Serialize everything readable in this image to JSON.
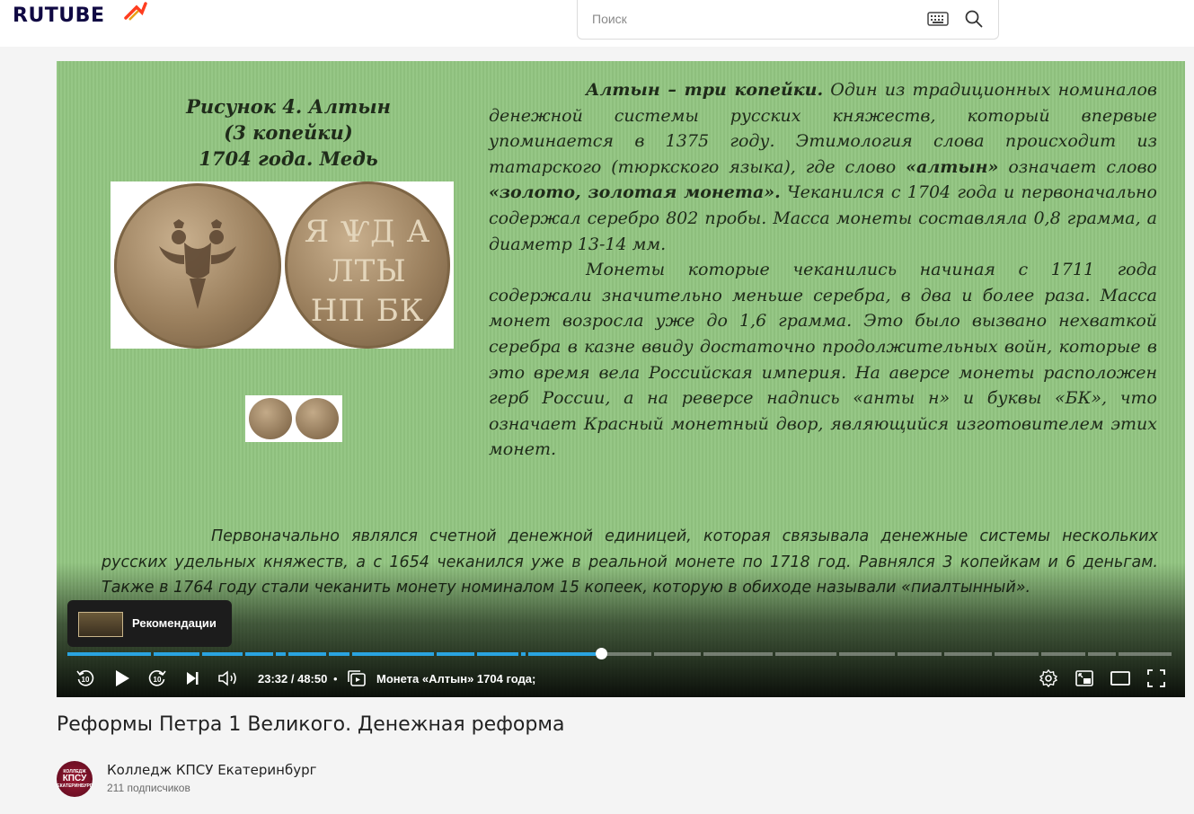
{
  "header": {
    "logo_text": "RUTUBE",
    "search_placeholder": "Поиск"
  },
  "slide": {
    "caption_line1": "Рисунок 4. Алтын",
    "caption_line2": "(3 копейки)",
    "caption_line3": "1704 года. Медь",
    "coin_back_text": "Я ѰД А ЛТЫ НП БК",
    "para1_title": "Алтын – три копейки.",
    "para1_text": "Один из традиционных номиналов денежной системы русских княжеств, который впервые упоминается в 1375 году. Этимология слова происходит из татарского (тюркского языка), где слово",
    "para1_word": "«алтын»",
    "para1_means": "означает слово",
    "para1_gold": "«золото, золотая монета».",
    "para1_rest": "Чеканился с 1704 года и первоначально содержал серебро 802 пробы. Масса монеты составляла 0,8 грамма, а диаметр 13-14 мм.",
    "para2_text": "Монеты которые чеканились начиная с 1711 года содержали значительно меньше серебра, в два и более раза. Масса монет возросла уже до 1,6 грамма. Это было вызвано нехваткой серебра в казне ввиду достаточно продолжительных войн, которые в это время вела Российская империя. На аверсе монеты расположен герб России, а на реверсе надпись «анты н» и буквы «БК», что означает Красный монетный двор, являющийся изготовителем этих монет.",
    "bottom_text": "Первоначально являлся счетной денежной единицей, которая связывала денежные системы нескольких русских удельных княжеств, а с 1654 чеканился уже в реальной монете по 1718 год. Равнялся 3 копейкам и 6 деньгам.  Также в 1764 году стали чеканить монету номиналом 15 копеек, которую в обиходе называли «пиалтынный»."
  },
  "player": {
    "recommendations_label": "Рекомендации",
    "time_current": "23:32",
    "time_total": "48:50",
    "time_display": "23:32 / 48:50",
    "separator": "•",
    "chapter_title": "Монета «Алтын» 1704 года;",
    "progress_fraction": 0.482,
    "accent_color": "#2aa4e0"
  },
  "video": {
    "title": "Реформы Петра 1 Великого. Денежная реформа"
  },
  "channel": {
    "name": "Колледж КПСУ Екатеринбург",
    "subscribers": "211 подписчиков",
    "avatar_text": "КОЛЛЕДЖ КПСУ ЕКАТЕРИНБУРГ"
  },
  "icons": {
    "rewind": "rewind-10-icon",
    "play": "play-icon",
    "forward": "forward-10-icon",
    "next": "skip-next-icon",
    "volume": "volume-icon",
    "chapters": "chapters-icon",
    "settings": "gear-icon",
    "pip": "picture-in-picture-icon",
    "theater": "theater-mode-icon",
    "fullscreen": "fullscreen-icon"
  }
}
